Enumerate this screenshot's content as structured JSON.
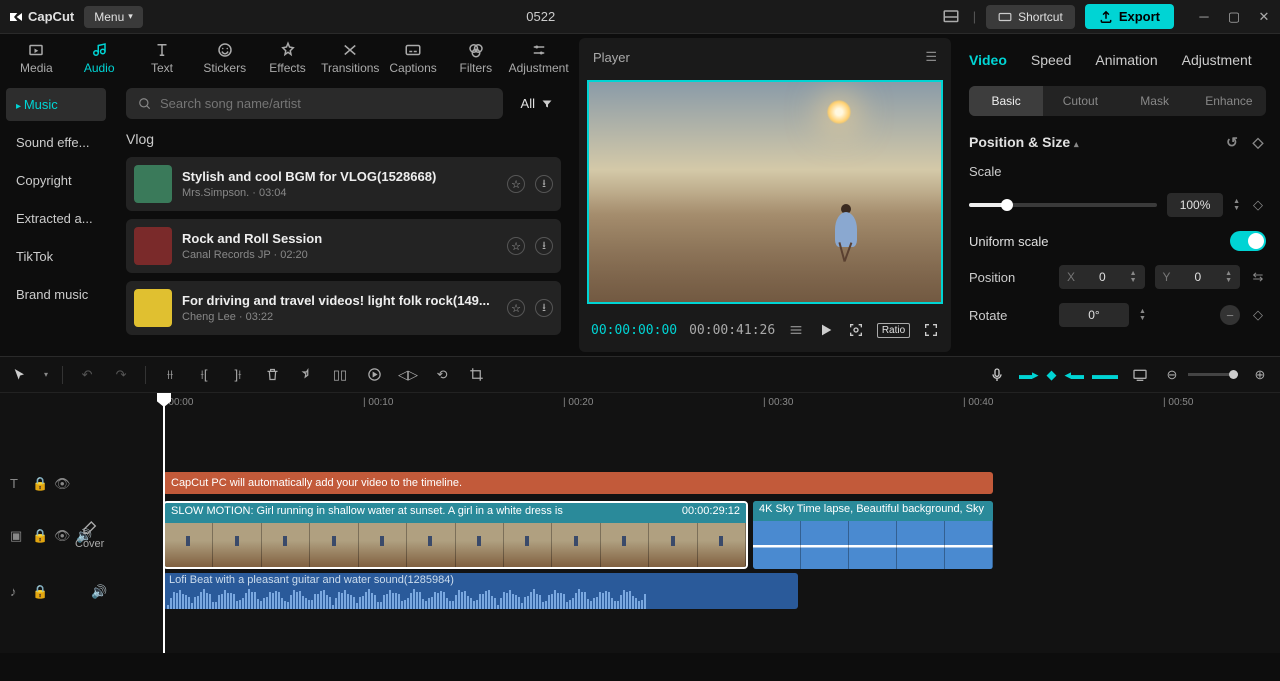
{
  "app": {
    "name": "CapCut",
    "menu": "Menu",
    "project_title": "0522",
    "shortcut": "Shortcut",
    "export": "Export"
  },
  "top_tabs": [
    "Media",
    "Audio",
    "Text",
    "Stickers",
    "Effects",
    "Transitions",
    "Captions",
    "Filters",
    "Adjustment"
  ],
  "top_tabs_active": 1,
  "sidebar": {
    "items": [
      "Music",
      "Sound effe...",
      "Copyright",
      "Extracted a...",
      "TikTok",
      "Brand music"
    ],
    "active": 0
  },
  "search": {
    "placeholder": "Search song name/artist",
    "filter_label": "All"
  },
  "section_title": "Vlog",
  "tracks": [
    {
      "title": "Stylish and cool BGM for VLOG(1528668)",
      "meta": "Mrs.Simpson. · 03:04",
      "color": "#3a7a5a"
    },
    {
      "title": "Rock and Roll Session",
      "meta": "Canal Records JP · 02:20",
      "color": "#7a2a2a"
    },
    {
      "title": "For driving and travel videos! light folk rock(149...",
      "meta": "Cheng Lee · 03:22",
      "color": "#e0c030"
    }
  ],
  "player": {
    "title": "Player",
    "time_current": "00:00:00:00",
    "time_total": "00:00:41:26",
    "ratio": "Ratio"
  },
  "right_tabs": {
    "items": [
      "Video",
      "Speed",
      "Animation",
      "Adjustment"
    ],
    "active": 0
  },
  "sub_tabs": {
    "items": [
      "Basic",
      "Cutout",
      "Mask",
      "Enhance"
    ],
    "active": 0
  },
  "props": {
    "section": "Position & Size",
    "scale_label": "Scale",
    "scale_value": "100%",
    "uniform_label": "Uniform scale",
    "uniform_on": true,
    "position_label": "Position",
    "x_label": "X",
    "x_val": "0",
    "y_label": "Y",
    "y_val": "0",
    "rotate_label": "Rotate",
    "rotate_val": "0°"
  },
  "ruler_ticks": [
    "00:00",
    "00:10",
    "00:20",
    "00:30",
    "00:40",
    "00:50"
  ],
  "timeline_clips": {
    "text": "CapCut PC will automatically add your video to the timeline.",
    "video1_label": "SLOW MOTION: Girl running in shallow water at sunset. A girl in a white dress is",
    "video1_dur": "00:00:29:12",
    "video2_label": "4K Sky Time lapse, Beautiful background, Sky",
    "audio_label": "Lofi Beat with a pleasant guitar and water sound(1285984)"
  },
  "cover_label": "Cover"
}
